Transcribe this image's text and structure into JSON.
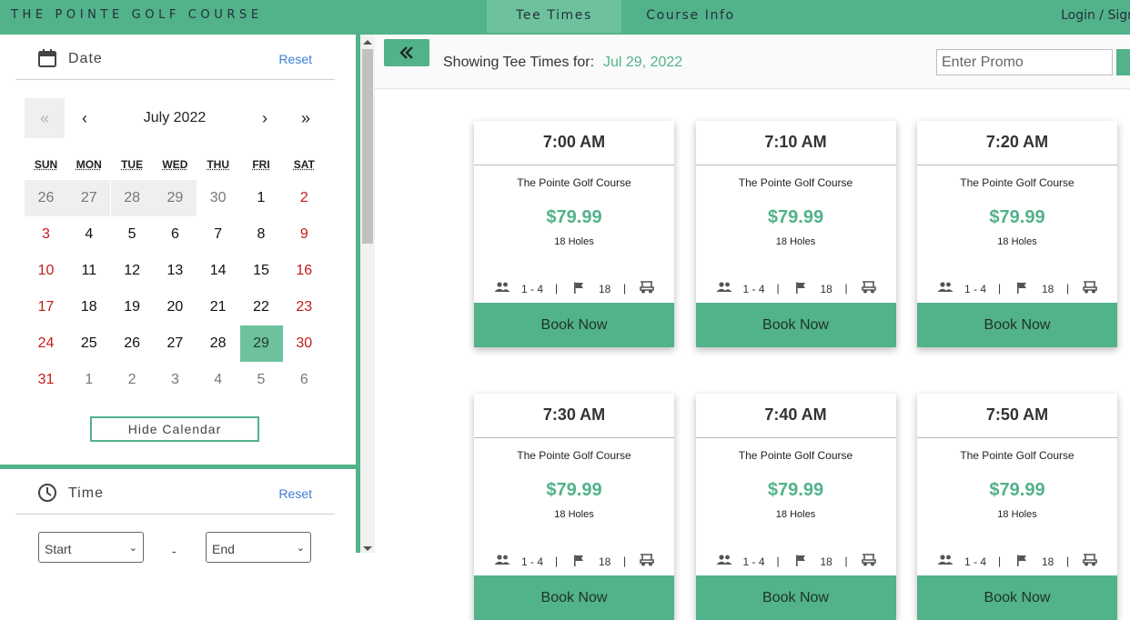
{
  "header": {
    "brand": "THE POINTE GOLF COURSE",
    "tabs": [
      {
        "label": "Tee Times",
        "active": true
      },
      {
        "label": "Course Info",
        "active": false
      }
    ],
    "login": "Login / Sign"
  },
  "date_panel": {
    "title": "Date",
    "reset": "Reset",
    "month_label": "July 2022",
    "nav": {
      "prev_year": "«",
      "prev_month": "‹",
      "next_month": "›",
      "next_year": "»"
    },
    "weekdays": [
      "SUN",
      "MON",
      "TUE",
      "WED",
      "THU",
      "FRI",
      "SAT"
    ],
    "weeks": [
      [
        "26",
        "27",
        "28",
        "29",
        "30",
        "1",
        "2"
      ],
      [
        "3",
        "4",
        "5",
        "6",
        "7",
        "8",
        "9"
      ],
      [
        "10",
        "11",
        "12",
        "13",
        "14",
        "15",
        "16"
      ],
      [
        "17",
        "18",
        "19",
        "20",
        "21",
        "22",
        "23"
      ],
      [
        "24",
        "25",
        "26",
        "27",
        "28",
        "29",
        "30"
      ],
      [
        "31",
        "1",
        "2",
        "3",
        "4",
        "5",
        "6"
      ]
    ],
    "selected_day": "29",
    "hide_calendar": "Hide Calendar"
  },
  "time_panel": {
    "title": "Time",
    "reset": "Reset",
    "start_placeholder": "Start",
    "separator": "-",
    "end_placeholder": "End"
  },
  "main": {
    "showing_label": "Showing Tee Times for:",
    "showing_date": "Jul 29, 2022",
    "promo_placeholder": "Enter Promo",
    "collapse_icon": "double-chevron-left-icon"
  },
  "tee_times": [
    {
      "time": "7:00 AM",
      "course": "The Pointe Golf Course",
      "price": "$79.99",
      "holes": "18 Holes",
      "players": "1 - 4",
      "hole_count": "18",
      "book": "Book Now"
    },
    {
      "time": "7:10 AM",
      "course": "The Pointe Golf Course",
      "price": "$79.99",
      "holes": "18 Holes",
      "players": "1 - 4",
      "hole_count": "18",
      "book": "Book Now"
    },
    {
      "time": "7:20 AM",
      "course": "The Pointe Golf Course",
      "price": "$79.99",
      "holes": "18 Holes",
      "players": "1 - 4",
      "hole_count": "18",
      "book": "Book Now"
    },
    {
      "time": "7:30 AM",
      "course": "The Pointe Golf Course",
      "price": "$79.99",
      "holes": "18 Holes",
      "players": "1 - 4",
      "hole_count": "18",
      "book": "Book Now"
    },
    {
      "time": "7:40 AM",
      "course": "The Pointe Golf Course",
      "price": "$79.99",
      "holes": "18 Holes",
      "players": "1 - 4",
      "hole_count": "18",
      "book": "Book Now"
    },
    {
      "time": "7:50 AM",
      "course": "The Pointe Golf Course",
      "price": "$79.99",
      "holes": "18 Holes",
      "players": "1 - 4",
      "hole_count": "18",
      "book": "Book Now"
    }
  ],
  "colors": {
    "brand_green": "#52b28a",
    "active_tab": "#6dc29d",
    "weekend_red": "#c61a1a",
    "reset_blue": "#3d7fd4"
  }
}
